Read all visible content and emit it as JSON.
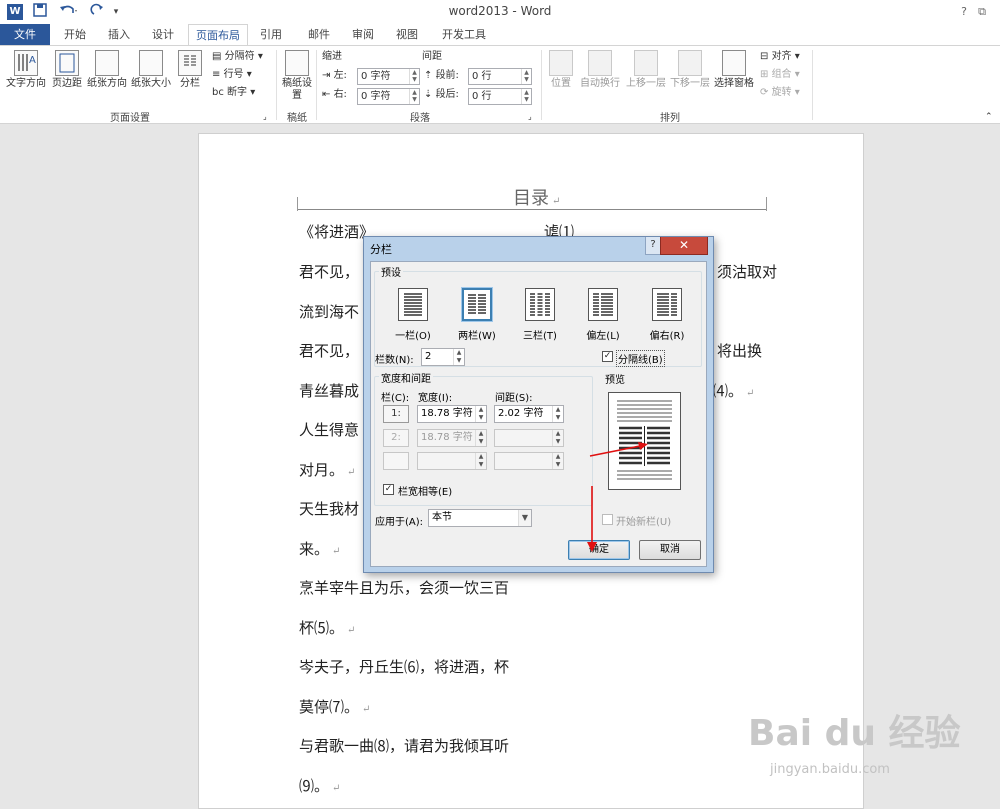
{
  "app": {
    "title": "word2013 - Word",
    "logo": "W"
  },
  "quick_access": [
    "save-icon",
    "undo-icon",
    "redo-icon",
    "customize-icon"
  ],
  "window_controls": {
    "help": "?",
    "restore": "⧉",
    "minimize": "—"
  },
  "tabs": [
    "文件",
    "开始",
    "插入",
    "设计",
    "页面布局",
    "引用",
    "邮件",
    "审阅",
    "视图",
    "开发工具"
  ],
  "ribbon": {
    "page_setup": {
      "text_direction": "文字方向",
      "margins": "页边距",
      "orientation": "纸张方向",
      "size": "纸张大小",
      "columns": "分栏",
      "breaks": "分隔符",
      "line_numbers": "行号",
      "hyphenation": "断字",
      "group_label": "页面设置"
    },
    "manuscript": {
      "button": "稿纸设置",
      "group_label": "稿纸"
    },
    "paragraph": {
      "indent_label": "缩进",
      "spacing_label": "间距",
      "left_label": "左:",
      "left_value": "0 字符",
      "right_label": "右:",
      "right_value": "0 字符",
      "before_label": "段前:",
      "before_value": "0 行",
      "after_label": "段后:",
      "after_value": "0 行",
      "group_label": "段落"
    },
    "arrange": {
      "position": "位置",
      "wrap_text": "自动换行",
      "bring_forward": "上移一层",
      "send_backward": "下移一层",
      "selection_pane": "选择窗格",
      "align": "对齐",
      "group": "组合",
      "rotate": "旋转",
      "group_label": "排列"
    }
  },
  "document": {
    "header_title": "目录",
    "lines": [
      "《将进酒》",
      "君不见，",
      "流到海不",
      "君不见，",
      "青丝暮成",
      "人生得意",
      "对月。",
      "天生我材",
      "来。",
      "烹羊宰牛且为乐，会须一饮三百",
      "杯⑸。",
      "岑夫子，丹丘生⑹，将进酒，杯",
      "莫停⑺。",
      "与君歌一曲⑻，请君为我倾耳听",
      "⑼。"
    ],
    "right_fragments": [
      "谑⑴",
      "须沽取对",
      "将出换",
      "⑷。"
    ],
    "para_mark": "↵"
  },
  "dialog": {
    "title": "分栏",
    "help": "?",
    "close": "✕",
    "presets_legend": "预设",
    "presets": [
      "一栏(O)",
      "两栏(W)",
      "三栏(T)",
      "偏左(L)",
      "偏右(R)"
    ],
    "selected_preset": "两栏(W)",
    "num_columns_label": "栏数(N):",
    "num_columns": "2",
    "line_between_label": "分隔线(B)",
    "line_between_checked": true,
    "width_spacing_legend": "宽度和间距",
    "col_header": "栏(C):",
    "width_header": "宽度(I):",
    "spacing_header": "间距(S):",
    "rows": [
      {
        "col": "1:",
        "width": "18.78 字符",
        "spacing": "2.02 字符",
        "enabled": true
      },
      {
        "col": "2:",
        "width": "18.78 字符",
        "spacing": "",
        "enabled": false
      },
      {
        "col": "",
        "width": "",
        "spacing": "",
        "enabled": false
      }
    ],
    "preview_legend": "预览",
    "equal_width_label": "栏宽相等(E)",
    "equal_width_checked": true,
    "apply_to_label": "应用于(A):",
    "apply_to_value": "本节",
    "start_new_column_label": "开始新栏(U)",
    "ok": "确定",
    "cancel": "取消"
  },
  "watermark": {
    "logo": "Bai du 经验",
    "url": "jingyan.baidu.com"
  },
  "colors": {
    "accent": "#2b579a",
    "dialog_frame": "#b9d1ea",
    "close_red": "#c74a3c",
    "annotation_red": "#e01010"
  }
}
